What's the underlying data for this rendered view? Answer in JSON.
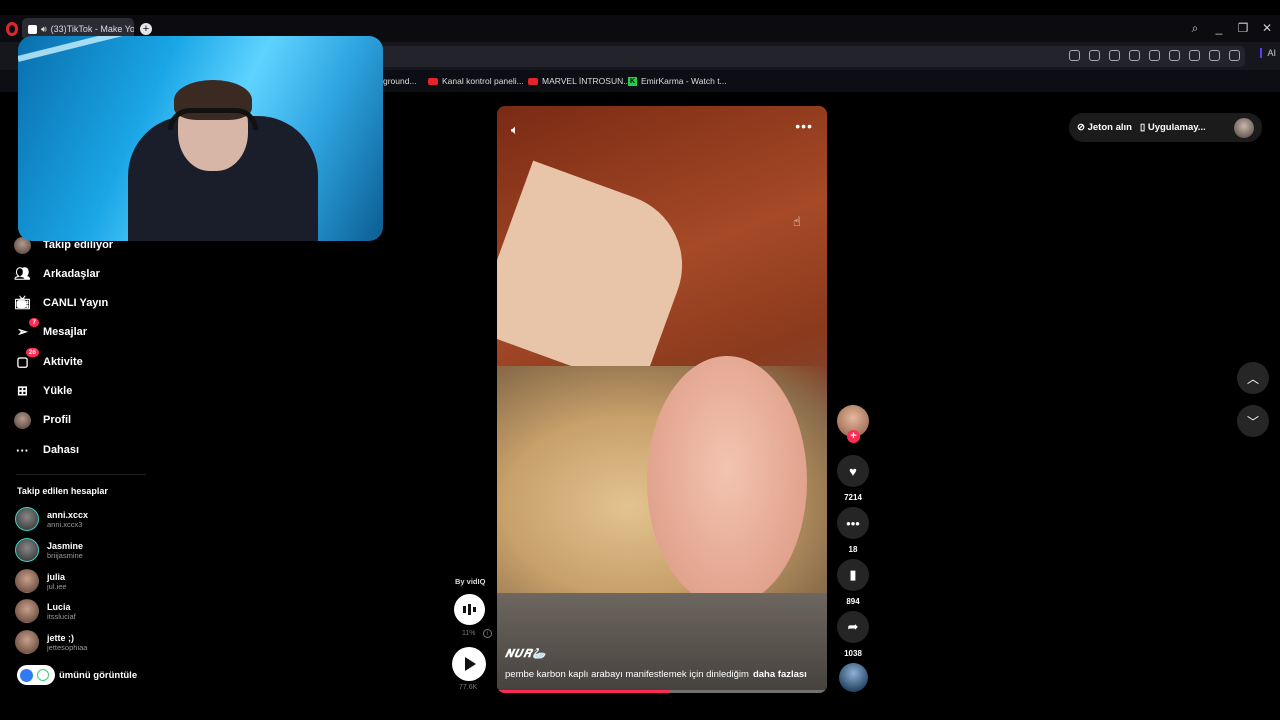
{
  "browser": {
    "tab_title": "(33)TikTok - Make You",
    "new_tab": "+",
    "controls": {
      "search": "⌕",
      "minimize": "_",
      "restore": "❐",
      "close": "✕"
    },
    "ai_label": "AI",
    "bookmarks": [
      {
        "label": "ground...",
        "icon": "none"
      },
      {
        "label": "Kanal kontrol paneli...",
        "icon": "youtube"
      },
      {
        "label": "MARVEL İNTROSUN...",
        "icon": "youtube"
      },
      {
        "label": "EmirKarma - Watch t...",
        "icon": "kick"
      }
    ]
  },
  "sidebar": {
    "nav": [
      {
        "label": "Takip ediliyor",
        "icon": "avatar",
        "badge": ""
      },
      {
        "label": "Arkadaşlar",
        "icon": "friends-icon",
        "badge": ""
      },
      {
        "label": "CANLI Yayın",
        "icon": "live-icon",
        "badge": ""
      },
      {
        "label": "Mesajlar",
        "icon": "messages-icon",
        "badge": "7"
      },
      {
        "label": "Aktivite",
        "icon": "activity-icon",
        "badge": "26"
      },
      {
        "label": "Yükle",
        "icon": "upload-icon",
        "badge": ""
      },
      {
        "label": "Profil",
        "icon": "profile-icon",
        "badge": ""
      },
      {
        "label": "Dahası",
        "icon": "more-icon",
        "badge": ""
      }
    ],
    "following_title": "Takip edilen hesaplar",
    "accounts": [
      {
        "name": "anni.xccx",
        "handle": "anni.xccx3"
      },
      {
        "name": "Jasmine",
        "handle": "briijasmine"
      },
      {
        "name": "julia",
        "handle": "jul.iee"
      },
      {
        "name": "Lucia",
        "handle": "itssluciaf"
      },
      {
        "name": "jette ;)",
        "handle": "jettesophiaa"
      }
    ],
    "show_all": "ümünü görüntüle"
  },
  "video": {
    "author_display": "𝑵𝑼𝑹🦢",
    "description": "pembe karbon kaplı arabayı manifestlemek için dinlediğim",
    "more_label": "daha fazlası",
    "progress": 0.52
  },
  "actions": {
    "likes": "7214",
    "comments": "18",
    "saves": "894",
    "shares": "1038"
  },
  "vidiq": {
    "by": "By vidIQ",
    "percent": "11%",
    "info": "i",
    "views": "77.6K"
  },
  "top_right": {
    "coins": "Jeton alın",
    "app": "Uygulamay..."
  }
}
